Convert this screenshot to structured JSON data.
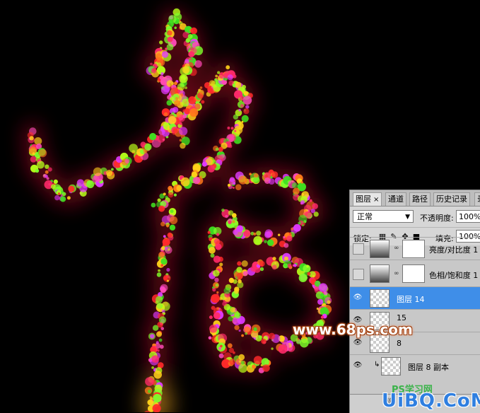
{
  "panel": {
    "tabs": [
      {
        "label": "图层",
        "close": "×"
      },
      {
        "label": "通道"
      },
      {
        "label": "路径"
      },
      {
        "label": "历史记录"
      },
      {
        "label": "录"
      }
    ],
    "blend_mode": "正常",
    "opacity_label": "不透明度:",
    "opacity_value": "100%",
    "lock_label": "锁定:",
    "fill_label": "填充:",
    "fill_value": "100%",
    "layers": [
      {
        "name": "亮度/对比度 1",
        "visible": false,
        "type": "adjustment"
      },
      {
        "name": "色相/饱和度 1",
        "visible": false,
        "type": "adjustment"
      },
      {
        "name": "图层 14",
        "visible": true,
        "selected": true
      },
      {
        "name": "15",
        "visible": true
      },
      {
        "name": "8",
        "visible": true
      },
      {
        "name": "图层 8 副本",
        "visible": true,
        "clipped": true
      }
    ]
  },
  "watermarks": {
    "site": "www.68ps.com",
    "logo_text": "UiBQ.CoM",
    "logo_sub": "PS学习网"
  },
  "colors": {
    "selection": "#3f8ee8",
    "background": "#000000"
  }
}
